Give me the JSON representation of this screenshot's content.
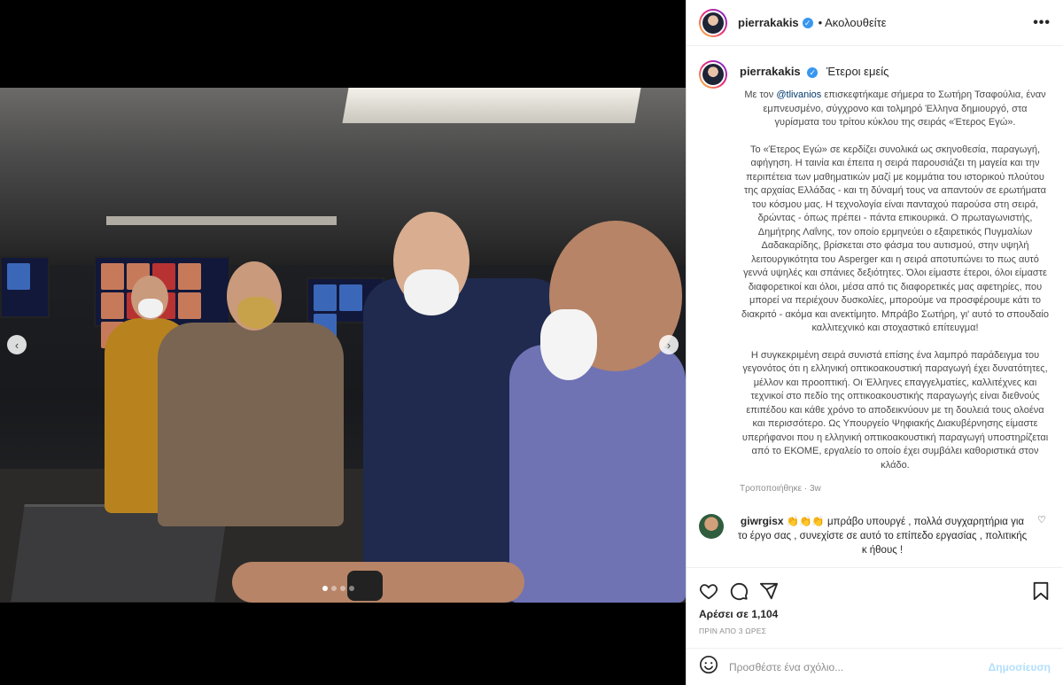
{
  "post": {
    "username": "pierrakakis",
    "follow_label": "• Ακολουθείτε",
    "more_label": "•••",
    "subtitle": "Έτεροι εμείς",
    "caption": [
      {
        "pre": "Με τον ",
        "mention": "@tlivanios",
        "post": " επισκεφτήκαμε σήμερα το Σωτήρη Τσαφούλια, έναν εμπνευσμένο, σύγχρονο και τολμηρό Έλληνα δημιουργό, στα γυρίσματα του τρίτου κύκλου της σειράς «Έτερος Εγώ»."
      },
      {
        "pre": "Το «Έτερος Εγώ» σε κερδίζει συνολικά ως σκηνοθεσία, παραγωγή, αφήγηση. Η ταινία και έπειτα η σειρά παρουσιάζει τη μαγεία και την περιπέτεια των μαθηματικών μαζί με κομμάτια του ιστορικού πλούτου της αρχαίας Ελλάδας - και τη δύναμή τους να απαντούν σε ερωτήματα του κόσμου μας. Η τεχνολογία είναι πανταχού παρούσα στη σειρά, δρώντας - όπως πρέπει - πάντα επικουρικά. Ο πρωταγωνιστής, Δημήτρης Λαΐνης, τον οποίο ερμηνεύει ο εξαιρετικός Πυγμαλίων Δαδακαρίδης, βρίσκεται στο φάσμα του αυτισμού, στην υψηλή λειτουργικότητα του Asperger και η σειρά αποτυπώνει το πως αυτό γεννά υψηλές και σπάνιες δεξιότητες. Όλοι είμαστε έτεροι, όλοι είμαστε διαφορετικοί και όλοι, μέσα από τις διαφορετικές μας αφετηρίες, που μπορεί να περιέχουν δυσκολίες, μπορούμε να προσφέρουμε κάτι το διακριτό - ακόμα και ανεκτίμητο. Μπράβο Σωτήρη, γι' αυτό το σπουδαίο καλλιτεχνικό και στοχαστικό επίτευγμα!",
        "mention": "",
        "post": ""
      },
      {
        "pre": "Η συγκεκριμένη σειρά συνιστά επίσης ένα λαμπρό παράδειγμα του γεγονότος ότι η ελληνική οπτικοακουστική παραγωγή έχει δυνατότητες, μέλλον και προοπτική. Οι Έλληνες επαγγελματίες, καλλιτέχνες και τεχνικοί στο πεδίο της οπτικοακουστικής παραγωγής είναι διεθνούς επιπέδου και κάθε χρόνο το αποδεικνύουν με τη δουλειά τους ολοένα και περισσότερο. Ως Υπουργείο Ψηφιακής Διακυβέρνησης είμαστε υπερήφανοι που η ελληνική οπτικοακουστική παραγωγή υποστηρίζεται από το ΕΚΟΜΕ, εργαλείο το οποίο έχει συμβάλει καθοριστικά στον κλάδο.",
        "mention": "",
        "post": ""
      }
    ],
    "edited_label": "Τροποποιήθηκε · 3w"
  },
  "comment": {
    "username": "giwrgisx",
    "emojis": "👏👏👏",
    "text": "μπράβο υπουργέ , πολλά συγχαρητήρια για το έργο σας , συνεχίστε σε αυτό το επίπεδο εργασίας , πολιτικής κ ήθους !"
  },
  "actions": {
    "likes": "Αρέσει σε 1,104",
    "time": "ΠΡΙΝ ΑΠΟ 3 ΩΡΕΣ",
    "comment_placeholder": "Προσθέστε ένα σχόλιο...",
    "publish_label": "Δημοσίευση",
    "emoji_icon": "smile-icon"
  },
  "carousel": {
    "total": 4,
    "active": 1
  },
  "colors": {
    "link": "#00376b",
    "verified": "#3897f0",
    "publish_disabled": "#b2dffc"
  }
}
